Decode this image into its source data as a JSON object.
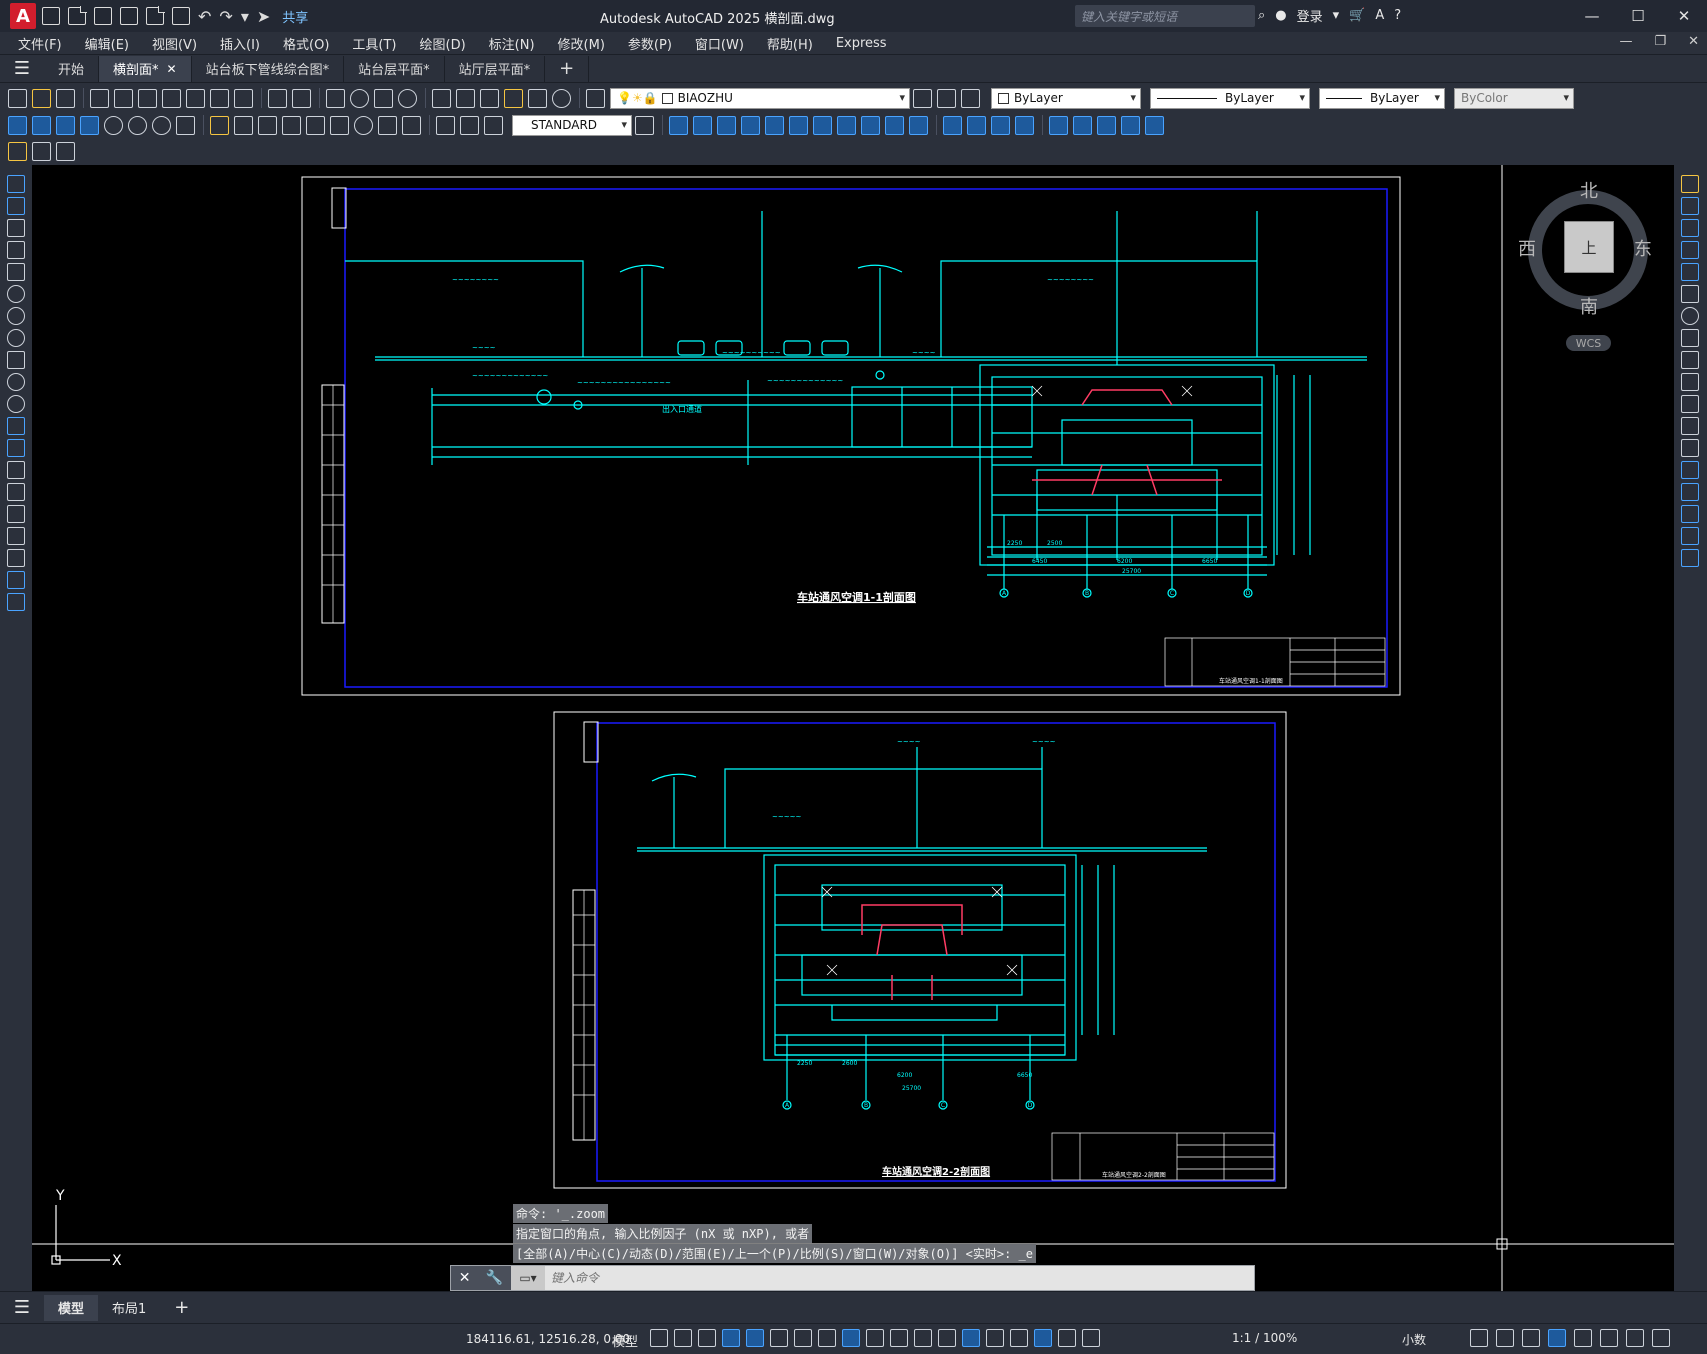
{
  "title_bar": {
    "app_logo": "A",
    "share_label": "共享",
    "title": "Autodesk AutoCAD 2025    横剖面.dwg",
    "search_placeholder": "键入关键字或短语",
    "login_label": "登录"
  },
  "menus": [
    "文件(F)",
    "编辑(E)",
    "视图(V)",
    "插入(I)",
    "格式(O)",
    "工具(T)",
    "绘图(D)",
    "标注(N)",
    "修改(M)",
    "参数(P)",
    "窗口(W)",
    "帮助(H)",
    "Express"
  ],
  "tabs": [
    {
      "label": "开始",
      "active": false,
      "closable": false
    },
    {
      "label": "横剖面*",
      "active": true,
      "closable": true
    },
    {
      "label": "站台板下管线综合图*",
      "active": false,
      "closable": false
    },
    {
      "label": "站台层平面*",
      "active": false,
      "closable": false
    },
    {
      "label": "站厅层平面*",
      "active": false,
      "closable": false
    }
  ],
  "toolbar": {
    "layer_name": "BIAOZHU",
    "text_style": "STANDARD",
    "color": "ByLayer",
    "linetype": "ByLayer",
    "lineweight": "ByLayer",
    "plotstyle": "ByColor"
  },
  "viewcube": {
    "north": "北",
    "south": "南",
    "east": "东",
    "west": "西",
    "face": "上",
    "wcs": "WCS"
  },
  "ucs": {
    "x_label": "X",
    "y_label": "Y"
  },
  "drawing1": {
    "title": "车站通风空调1-1剖面图",
    "label_entrance": "出入口通道",
    "dims_bottom": [
      "2250",
      "2500",
      "6450",
      "6200",
      "6650",
      "25700"
    ],
    "grid_labels": [
      "A",
      "B",
      "C",
      "D"
    ],
    "title_block_name": "车站通风空调1-1剖面图"
  },
  "drawing2": {
    "title": "车站通风空调2-2剖面图",
    "dims_bottom": [
      "2250",
      "2600",
      "6200",
      "6650",
      "25700"
    ],
    "grid_labels": [
      "A",
      "B",
      "C",
      "D"
    ],
    "title_block_name": "车站通风空调2-2剖面图"
  },
  "command": {
    "history": [
      "命令: '_.zoom",
      "指定窗口的角点, 输入比例因子 (nX 或 nXP), 或者",
      "[全部(A)/中心(C)/动态(D)/范围(E)/上一个(P)/比例(S)/窗口(W)/对象(O)] <实时>: _e"
    ],
    "placeholder": "键入命令"
  },
  "layouts": [
    {
      "label": "模型",
      "active": true
    },
    {
      "label": "布局1",
      "active": false
    }
  ],
  "status": {
    "coords": "184116.61, 12516.28, 0.00",
    "mode": "模型",
    "scale": "1:1 / 100%",
    "units": "小数"
  },
  "colors": {
    "drawing_cyan": "#00ffff",
    "border_blue": "#0000ff",
    "frame_white": "#ffffff",
    "duct_red": "#ff3c64",
    "accent": "#4aa3ff"
  }
}
